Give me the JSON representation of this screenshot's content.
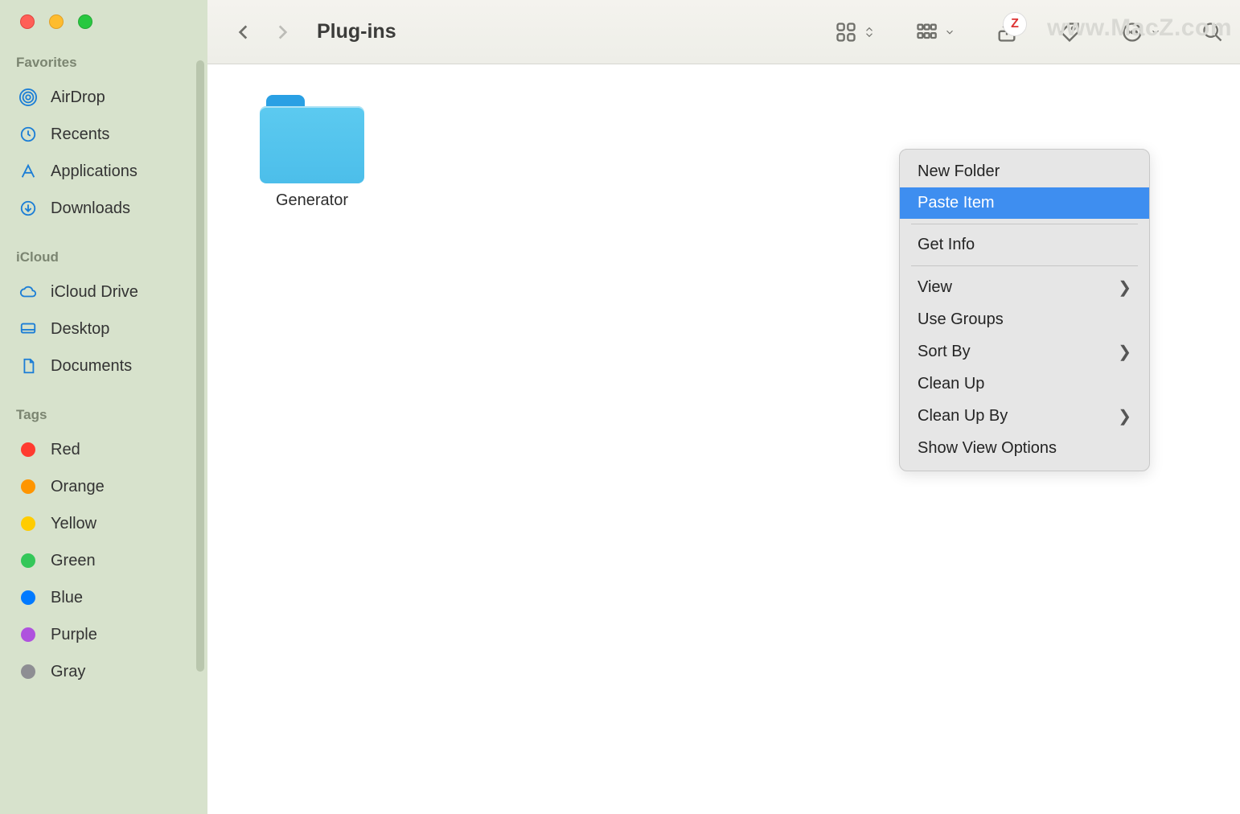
{
  "window_title": "Plug-ins",
  "watermark": "www.MacZ.com",
  "z_badge": "Z",
  "sidebar": {
    "sections": [
      {
        "label": "Favorites",
        "items": [
          {
            "key": "airdrop",
            "label": "AirDrop"
          },
          {
            "key": "recents",
            "label": "Recents"
          },
          {
            "key": "applications",
            "label": "Applications"
          },
          {
            "key": "downloads",
            "label": "Downloads"
          }
        ]
      },
      {
        "label": "iCloud",
        "items": [
          {
            "key": "icloud-drive",
            "label": "iCloud Drive"
          },
          {
            "key": "desktop",
            "label": "Desktop"
          },
          {
            "key": "documents",
            "label": "Documents"
          }
        ]
      },
      {
        "label": "Tags",
        "items": [
          {
            "key": "tag-red",
            "label": "Red",
            "color": "#ff3b30"
          },
          {
            "key": "tag-orange",
            "label": "Orange",
            "color": "#ff9500"
          },
          {
            "key": "tag-yellow",
            "label": "Yellow",
            "color": "#ffcc00"
          },
          {
            "key": "tag-green",
            "label": "Green",
            "color": "#34c759"
          },
          {
            "key": "tag-blue",
            "label": "Blue",
            "color": "#007aff"
          },
          {
            "key": "tag-purple",
            "label": "Purple",
            "color": "#af52de"
          },
          {
            "key": "tag-gray",
            "label": "Gray",
            "color": "#8e8e93"
          }
        ]
      }
    ]
  },
  "content": {
    "items": [
      {
        "name": "Generator",
        "type": "folder"
      }
    ]
  },
  "context_menu": {
    "groups": [
      [
        {
          "label": "New Folder",
          "submenu": false,
          "highlight": false
        },
        {
          "label": "Paste Item",
          "submenu": false,
          "highlight": true
        }
      ],
      [
        {
          "label": "Get Info",
          "submenu": false
        }
      ],
      [
        {
          "label": "View",
          "submenu": true
        },
        {
          "label": "Use Groups",
          "submenu": false
        },
        {
          "label": "Sort By",
          "submenu": true
        },
        {
          "label": "Clean Up",
          "submenu": false
        },
        {
          "label": "Clean Up By",
          "submenu": true
        },
        {
          "label": "Show View Options",
          "submenu": false
        }
      ]
    ]
  },
  "colors": {
    "sidebar_bg": "#d7e2cc",
    "accent": "#3e8ef0",
    "folder_blue": "#4cbeea"
  }
}
